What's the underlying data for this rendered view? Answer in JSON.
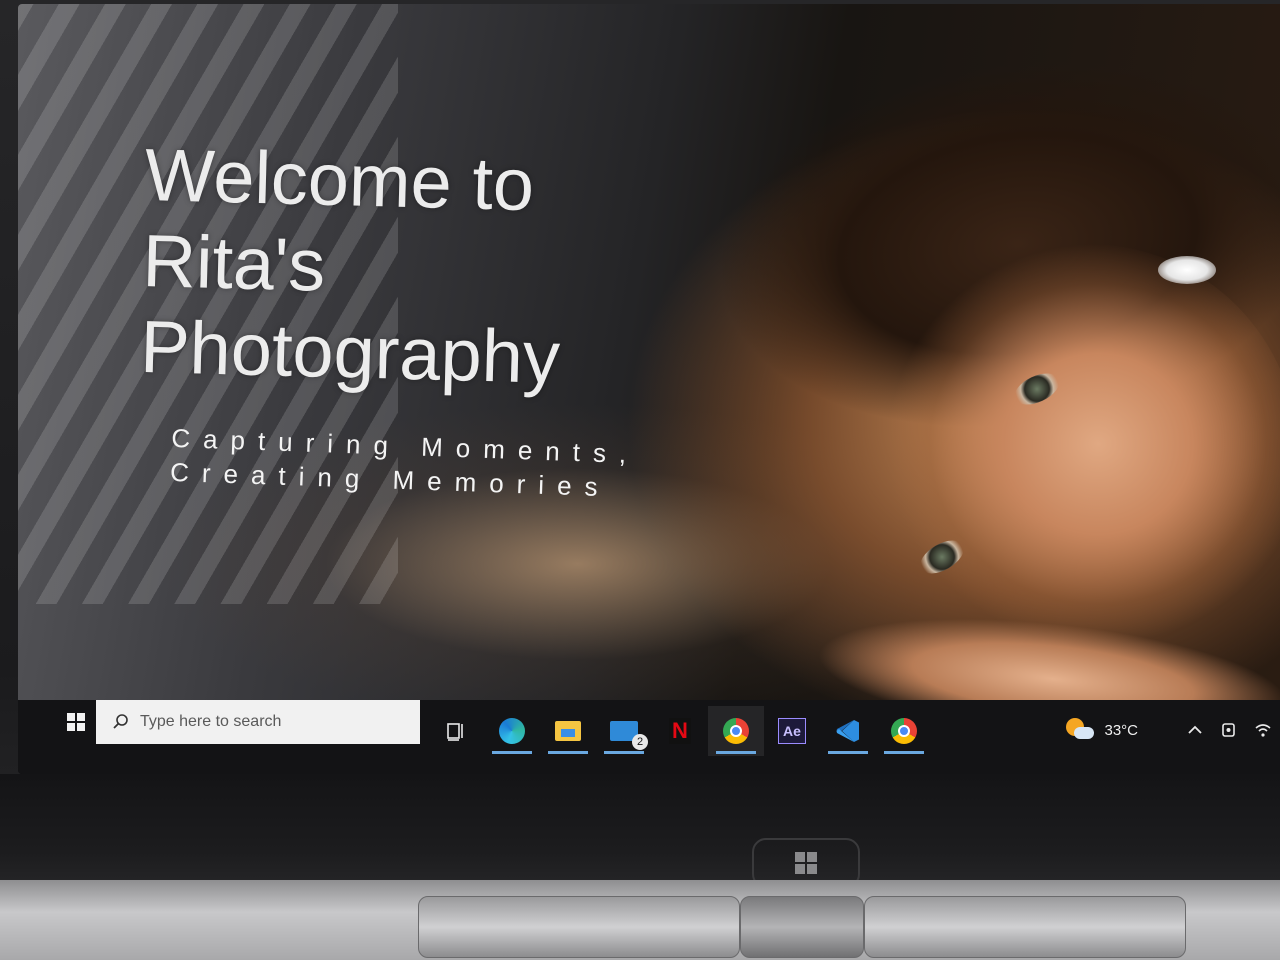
{
  "hero": {
    "title": "Welcome to\nRita's\nPhotography",
    "tagline": "Capturing Moments,\nCreating Memories"
  },
  "taskbar": {
    "search_placeholder": "Type here to search",
    "pinned_apps": [
      {
        "icon": "task-view-icon",
        "active": false
      },
      {
        "icon": "edge-icon",
        "active": false,
        "open": true
      },
      {
        "icon": "file-explorer-icon",
        "active": false,
        "open": true
      },
      {
        "icon": "mail-icon",
        "active": false,
        "open": true,
        "badge": "2"
      },
      {
        "icon": "netflix-icon",
        "active": false
      },
      {
        "icon": "chrome-profile-icon",
        "active": true,
        "open": true
      },
      {
        "icon": "after-effects-icon",
        "active": false
      },
      {
        "icon": "vscode-icon",
        "active": false,
        "open": true
      },
      {
        "icon": "chrome-icon",
        "active": false,
        "open": true
      }
    ],
    "weather": {
      "temperature": "33°C",
      "icon": "partly-sunny-icon"
    },
    "tray_icons": [
      "chevron-up-icon",
      "meet-now-icon",
      "wifi-icon"
    ]
  },
  "colors": {
    "taskbar_bg": "#131315",
    "accent_underline": "#6aa8e0",
    "hero_text": "#ececec"
  }
}
